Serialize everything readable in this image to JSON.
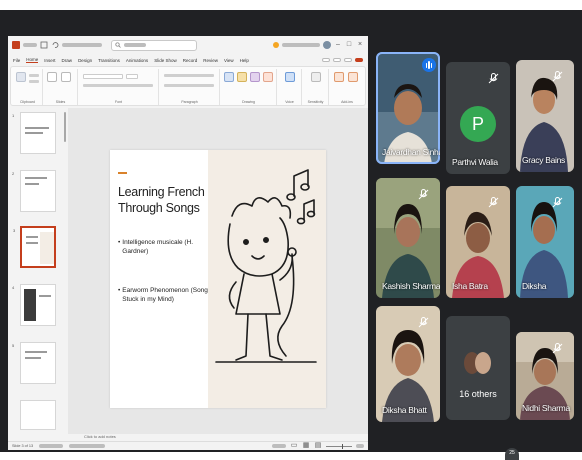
{
  "powerpoint": {
    "menu_tabs": [
      "File",
      "Home",
      "Insert",
      "Draw",
      "Design",
      "Transitions",
      "Animations",
      "Slide Show",
      "Record",
      "Review",
      "View",
      "Help"
    ],
    "active_tab": "Home",
    "ribbon_groups": [
      "Clipboard",
      "Slides",
      "Font",
      "Paragraph",
      "Drawing",
      "Voice",
      "Sensitivity",
      "Add-ins"
    ],
    "notes_placeholder": "Click to add notes",
    "slide_thumbnail_numbers": [
      "1",
      "2",
      "3",
      "4",
      "5"
    ],
    "slide": {
      "title": "Learning French Through Songs",
      "bullets": [
        "Intelligence musicale (H. Gardner)",
        "Earworm Phenomenon (Song Stuck in my Mind)"
      ],
      "accent_color": "#d9822b"
    },
    "status": {
      "slide_position": "Slide 3 of 13"
    }
  },
  "participants": [
    {
      "name": "Jaivardhan Sinha",
      "speaking": true,
      "muted": false
    },
    {
      "name": "Parthvi Walia",
      "avatar_letter": "P",
      "avatar_color": "#34a853",
      "muted": true
    },
    {
      "name": "Gracy Bains",
      "muted": true
    },
    {
      "name": "Kashish Sharma",
      "muted": true
    },
    {
      "name": "Isha Batra",
      "muted": true
    },
    {
      "name": "Diksha",
      "muted": true
    },
    {
      "name": "Diksha Bhatt",
      "muted": true
    },
    {
      "others_label": "16 others"
    },
    {
      "name": "Nidhi Sharma",
      "muted": true
    }
  ],
  "colors": {
    "meet_background": "#202124",
    "tile_background": "#3c4043",
    "speaking_accent": "#1a73e8",
    "ppt_brand": "#c43e1c"
  },
  "floating_count": "25"
}
